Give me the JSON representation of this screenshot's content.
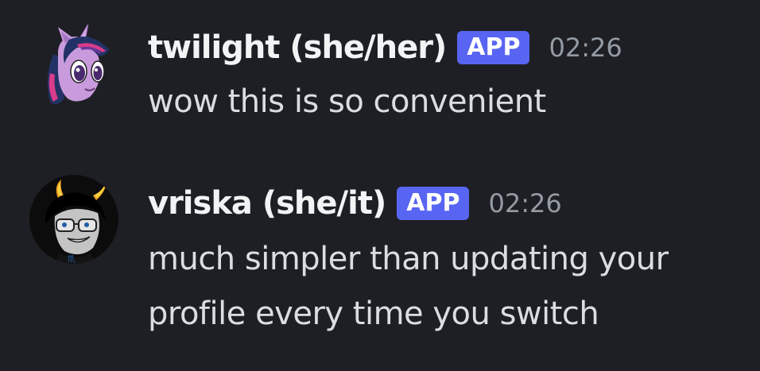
{
  "messages": [
    {
      "author": "twilight (she/her)",
      "badge": "APP",
      "time": "02:26",
      "avatar_icon": "twilight-sparkle-pony-avatar",
      "lines": [
        "wow this is so convenient"
      ]
    },
    {
      "author": "vriska (she/it)",
      "badge": "APP",
      "time": "02:26",
      "avatar_icon": "vriska-troll-avatar",
      "lines": [
        "much simpler than updating your",
        "profile every time you switch"
      ]
    }
  ],
  "colors": {
    "background": "#1e1f24",
    "username": "#f2f3f5",
    "message_text": "#dbdee1",
    "timestamp": "#949ba4",
    "app_badge": "#5865f2"
  }
}
